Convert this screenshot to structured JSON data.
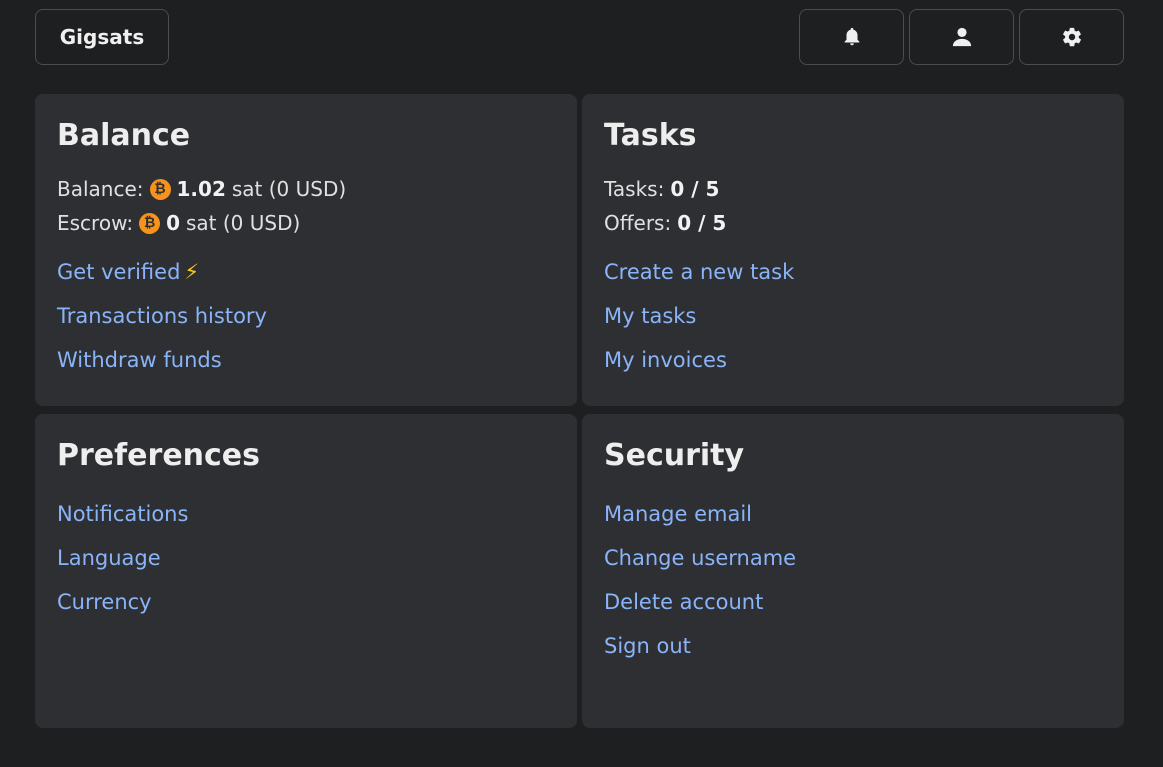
{
  "header": {
    "brand_label": "Gigsats",
    "icons": [
      "bell-icon",
      "user-icon",
      "gear-icon"
    ]
  },
  "balance_card": {
    "title": "Balance",
    "balance_label": "Balance:",
    "balance_amount": "1.02",
    "balance_suffix": "sat (0 USD)",
    "escrow_label": "Escrow:",
    "escrow_amount": "0",
    "escrow_suffix": "sat (0 USD)",
    "btc_glyph": "₿",
    "bolt_glyph": "⚡",
    "links": [
      "Get verified",
      "Transactions history",
      "Withdraw funds"
    ]
  },
  "tasks_card": {
    "title": "Tasks",
    "tasks_label": "Tasks:",
    "tasks_value": "0 / 5",
    "offers_label": "Offers:",
    "offers_value": "0 / 5",
    "links": [
      "Create a new task",
      "My tasks",
      "My invoices"
    ]
  },
  "preferences_card": {
    "title": "Preferences",
    "links": [
      "Notifications",
      "Language",
      "Currency"
    ]
  },
  "security_card": {
    "title": "Security",
    "links": [
      "Manage email",
      "Change username",
      "Delete account",
      "Sign out"
    ]
  },
  "colors": {
    "background": "#1e1f21",
    "card": "#2e2f32",
    "link": "#8ab4f8",
    "bitcoin": "#f7931a"
  }
}
